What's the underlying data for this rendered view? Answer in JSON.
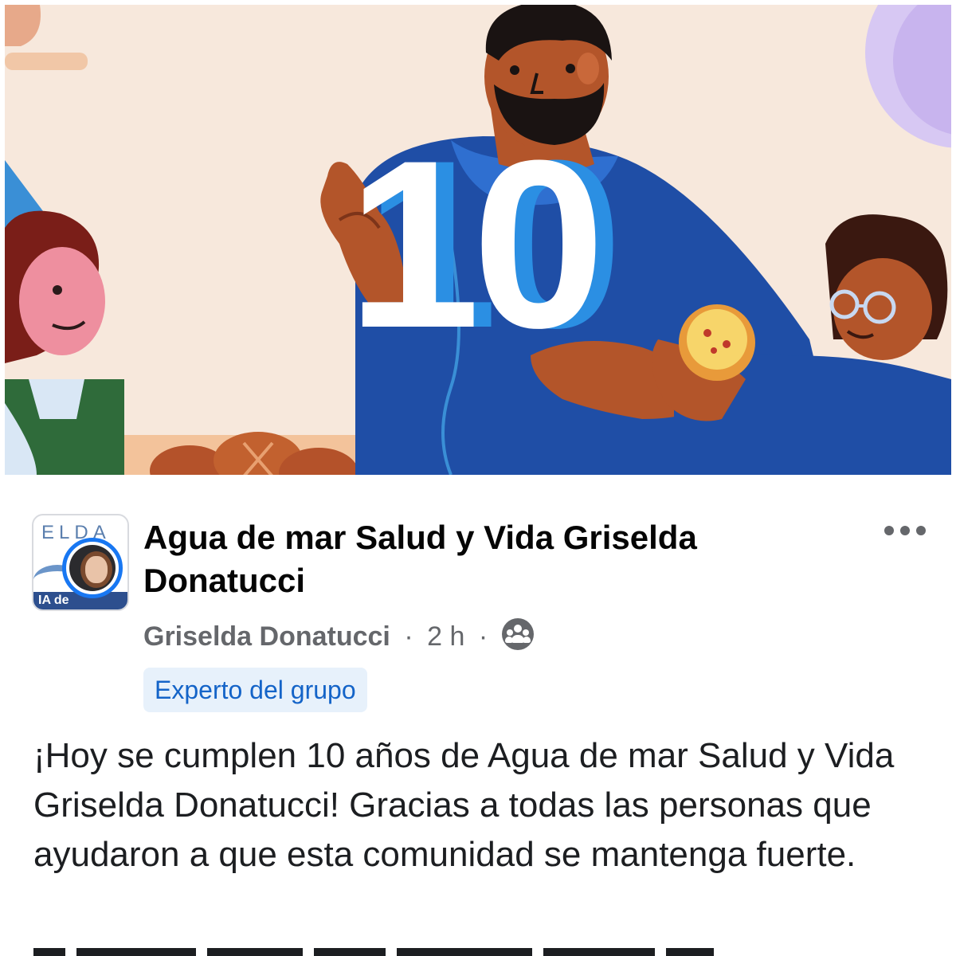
{
  "banner": {
    "number": "10",
    "colors": {
      "background": "#f7e8dc",
      "accent_blue": "#2b8fe3",
      "shirt_blue": "#1f4ea6"
    }
  },
  "post": {
    "group_name": "Agua de mar Salud y  Vida Griselda Donatucci",
    "group_avatar": {
      "top_text": "ELDA",
      "bottom_text": "IA de"
    },
    "author": "Griselda Donatucci",
    "separator": "·",
    "time": "2 h",
    "audience_icon": "group-icon",
    "badge": "Experto del grupo",
    "body": "¡Hoy se cumplen 10 años de Agua de mar Salud y Vida Griselda Donatucci! Gracias a todas las personas que ayudaron a que esta comunidad se mantenga fuerte.",
    "more_icon": "more-options-icon"
  }
}
